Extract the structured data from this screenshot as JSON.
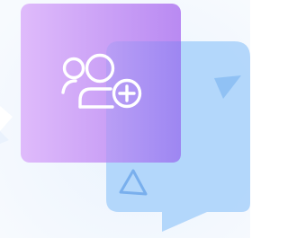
{
  "illustration": {
    "icon": "add-user-icon",
    "front_card_icon": "user-group-plus-icon",
    "back_bubble_icons": [
      "triangle-icon",
      "triangle-outline-icon"
    ],
    "colors": {
      "background": "#f5f9fe",
      "purple_gradient_start": "#dfbbfb",
      "purple_gradient_end": "#b98af2",
      "bubble_blue": "#aed4fb",
      "overlap_violet": "#a58df4",
      "icon_stroke": "#ffffff",
      "triangle_fill": "#84baf2",
      "triangle_stroke": "#6ea8ea"
    }
  }
}
